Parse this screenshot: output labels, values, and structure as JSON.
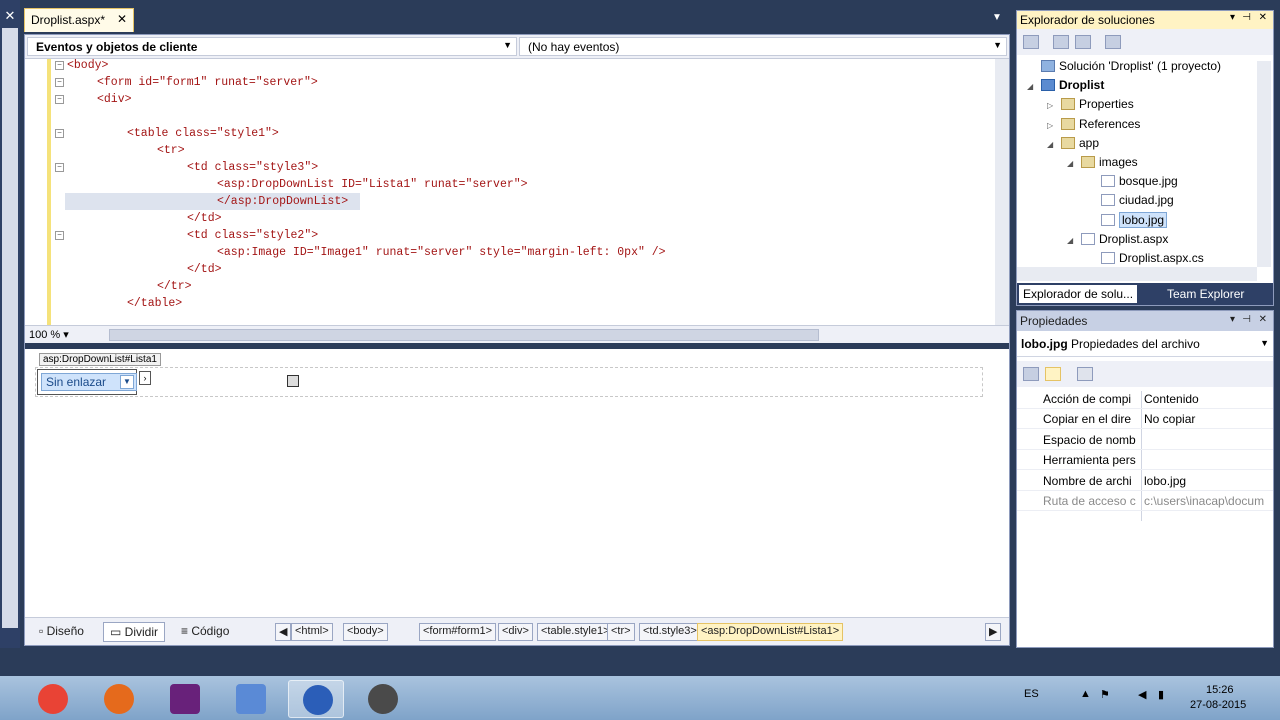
{
  "doc_tab": {
    "title": "Droplist.aspx*",
    "close": "✕"
  },
  "nav": {
    "left": "Eventos y objetos de cliente",
    "right": "(No hay eventos)"
  },
  "code_lines": [
    {
      "indent": 0,
      "text": "<body>"
    },
    {
      "indent": 4,
      "text": "<form id=\"form1\" runat=\"server\">"
    },
    {
      "indent": 4,
      "text": "<div>"
    },
    {
      "indent": 0,
      "text": ""
    },
    {
      "indent": 8,
      "text": "<table class=\"style1\">"
    },
    {
      "indent": 12,
      "text": "<tr>"
    },
    {
      "indent": 16,
      "text": "<td class=\"style3\">"
    },
    {
      "indent": 20,
      "text": "<asp:DropDownList ID=\"Lista1\" runat=\"server\">"
    },
    {
      "indent": 20,
      "text": "</asp:DropDownList>"
    },
    {
      "indent": 16,
      "text": "</td>"
    },
    {
      "indent": 16,
      "text": "<td class=\"style2\">"
    },
    {
      "indent": 20,
      "text": "<asp:Image ID=\"Image1\" runat=\"server\" style=\"margin-left: 0px\" />"
    },
    {
      "indent": 16,
      "text": "</td>"
    },
    {
      "indent": 12,
      "text": "</tr>"
    },
    {
      "indent": 8,
      "text": "</table>"
    }
  ],
  "zoom": "100 %",
  "design": {
    "control_tag": "asp:DropDownList#Lista1",
    "dropdown_text": "Sin enlazar"
  },
  "views": {
    "design": "Diseño",
    "split": "Dividir",
    "code": "Código"
  },
  "breadcrumbs": [
    "<html>",
    "<body>",
    "<form#form1>",
    "<div>",
    "<table.style1>",
    "<tr>",
    "<td.style3>",
    "<asp:DropDownList#Lista1>"
  ],
  "solution_explorer": {
    "title": "Explorador de soluciones",
    "items": [
      {
        "label": "Solución 'Droplist'  (1 proyecto)",
        "level": 0,
        "icon": "solution-icon",
        "exp": ""
      },
      {
        "label": "Droplist",
        "level": 0,
        "icon": "project-icon",
        "exp": "◢",
        "bold": true
      },
      {
        "label": "Properties",
        "level": 1,
        "icon": "folder-icon",
        "exp": "▷"
      },
      {
        "label": "References",
        "level": 1,
        "icon": "folder-icon",
        "exp": "▷"
      },
      {
        "label": "app",
        "level": 1,
        "icon": "folder-icon",
        "exp": "◢"
      },
      {
        "label": "images",
        "level": 2,
        "icon": "folder-icon",
        "exp": "◢"
      },
      {
        "label": "bosque.jpg",
        "level": 3,
        "icon": "file-icon",
        "exp": ""
      },
      {
        "label": "ciudad.jpg",
        "level": 3,
        "icon": "file-icon",
        "exp": ""
      },
      {
        "label": "lobo.jpg",
        "level": 3,
        "icon": "file-icon",
        "exp": "",
        "selected": true
      },
      {
        "label": "Droplist.aspx",
        "level": 2,
        "icon": "file-icon",
        "exp": "◢"
      },
      {
        "label": "Droplist.aspx.cs",
        "level": 3,
        "icon": "file-icon",
        "exp": ""
      }
    ],
    "tabs": [
      "Explorador de solu...",
      "Team Explorer"
    ]
  },
  "properties": {
    "title": "Propiedades",
    "object_name": "lobo.jpg",
    "object_type": "Propiedades del archivo",
    "rows": [
      {
        "key": "Acción de compi",
        "value": "Contenido"
      },
      {
        "key": "Copiar en el dire",
        "value": "No copiar"
      },
      {
        "key": "Espacio de nomb",
        "value": ""
      },
      {
        "key": "Herramienta pers",
        "value": ""
      },
      {
        "key": "Nombre de archi",
        "value": "lobo.jpg"
      },
      {
        "key": "Ruta de acceso c",
        "value": "c:\\users\\inacap\\docum",
        "disabled": true
      }
    ]
  },
  "taskbar": {
    "apps": [
      "chrome-icon",
      "firefox-icon",
      "visual-studio-icon",
      "virtualbox-icon",
      "infinity-app-icon",
      "camera-app-icon"
    ],
    "lang": "ES",
    "time": "15:26",
    "date": "27-08-2015"
  }
}
